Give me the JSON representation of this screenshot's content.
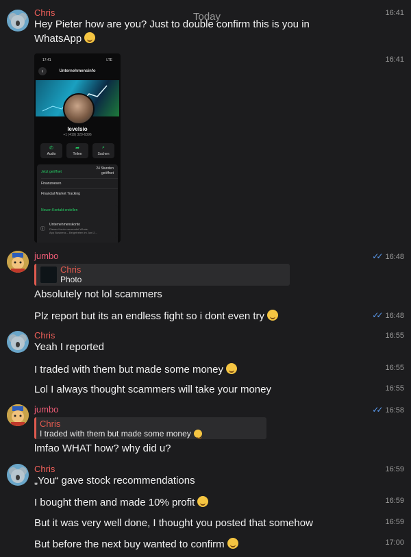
{
  "day_separator": "Today",
  "messages": {
    "m1": {
      "sender": "Chris",
      "line1": "Hey Pieter how are you? Just to double confirm this is you in",
      "line2": "WhatsApp",
      "time": "16:41"
    },
    "m2": {
      "time": "16:41"
    },
    "m3": {
      "sender": "jumbo",
      "quote_name": "Chris",
      "quote_text": "Photo",
      "text": "Absolutely not lol scammers",
      "time": "16:48"
    },
    "m4": {
      "text": "Plz report but its an endless fight so i dont even try",
      "time": "16:48"
    },
    "m5": {
      "sender": "Chris",
      "text": "Yeah I reported",
      "time": "16:55"
    },
    "m6": {
      "text": "I traded with them but made some money",
      "time": "16:55"
    },
    "m7": {
      "text": "Lol I always thought scammers will take your money",
      "time": "16:55"
    },
    "m8": {
      "sender": "jumbo",
      "quote_name": "Chris",
      "quote_text": "I traded with them but made some money",
      "text": "lmfao WHAT how? why did u?",
      "time": "16:58"
    },
    "m9": {
      "sender": "Chris",
      "text": "„You“ gave stock recommendations",
      "time": "16:59"
    },
    "m10": {
      "text": "I bought them and made 10% profit",
      "time": "16:59"
    },
    "m11": {
      "text": "But it was very well done, I thought you posted that somehow",
      "time": "16:59"
    },
    "m12": {
      "text": "But before the next buy wanted to confirm",
      "time": "17:00"
    }
  },
  "screenshot": {
    "status_time": "17:41",
    "status_right": "LTE",
    "title": "Unternehmensinfo",
    "name": "levelsio",
    "phone": "+1 (419) 320-6396",
    "actions": [
      {
        "icon": "phone-icon",
        "label": "Audio"
      },
      {
        "icon": "share-icon",
        "label": "Teilen"
      },
      {
        "icon": "search-icon",
        "label": "Suchen"
      }
    ],
    "hours_status": "Jetzt geöffnet",
    "hours_value_1": "24 Stunden",
    "hours_value_2": "geöffnet",
    "category_1": "Finanzwesen",
    "category_2": "Financial Market Tracking",
    "new_contact": "Neuen Kontakt erstellen",
    "business_title": "Unternehmenskonto",
    "business_desc_1": "Dieses Konto verwendet Whats-",
    "business_desc_2": "App Business – Beigetreten im Juni 2..."
  },
  "colors": {
    "background": "#1c1c1e",
    "chris": "#f0605a",
    "jumbo": "#ec5b75",
    "read_ticks": "#5b9bf0",
    "whatsapp_green": "#25d366"
  }
}
